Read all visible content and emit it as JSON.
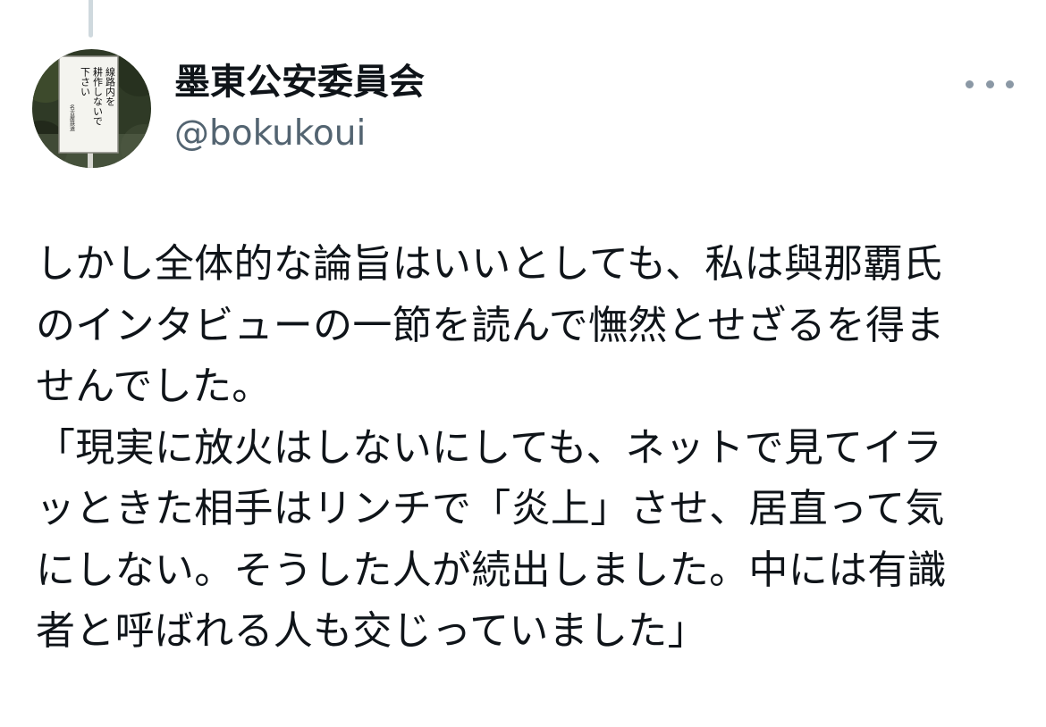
{
  "author": {
    "display_name": "墨東公安委員会",
    "handle": "@bokukoui",
    "avatar_sign_lines": [
      "線路内を",
      "耕作しないで",
      "下さい",
      "名古屋鉄道"
    ]
  },
  "more_menu_icon": "more-horizontal-icon",
  "tweet": {
    "lines": [
      "しかし全体的な論旨はいいとしても、私は與那覇氏",
      "のインタビューの一節を読んで憮然とせざるを得ま",
      "せんでした。",
      "「現実に放火はしないにしても、ネットで見てイラ",
      "ッときた相手はリンチで「炎上」させ、居直って気",
      "にしない。そうした人が続出しました。中には有識",
      "者と呼ばれる人も交じっていました」"
    ]
  },
  "colors": {
    "text": "#0f1419",
    "secondary_text": "#536471",
    "thread_line": "#cfd9de",
    "background": "#ffffff"
  }
}
